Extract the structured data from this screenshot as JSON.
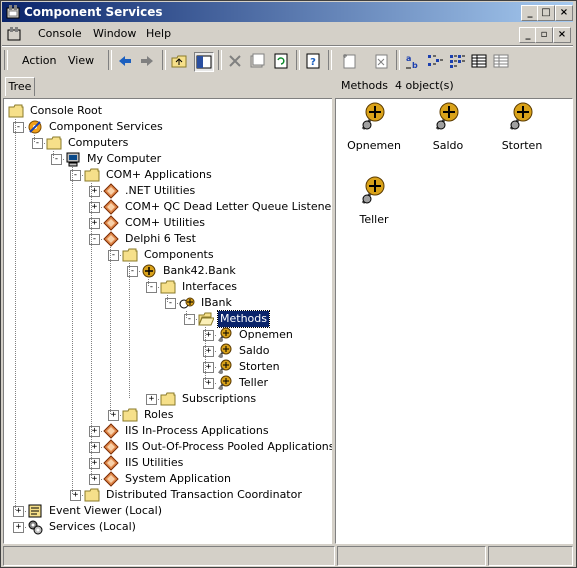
{
  "window": {
    "title": "Component Services",
    "controls": [
      "_",
      "□",
      "×"
    ],
    "inner_controls": [
      "_",
      "▫",
      "×"
    ]
  },
  "menubar": {
    "items": [
      "Console",
      "Window",
      "Help"
    ]
  },
  "toolbar": {
    "action_label": "Action",
    "view_label": "View"
  },
  "tree_tab": {
    "label": "Tree"
  },
  "tree": {
    "nodes": [
      {
        "label": "Console Root",
        "icon": "folder-icon"
      },
      {
        "label": "Component Services",
        "icon": "component-services-icon"
      },
      {
        "label": "Computers",
        "icon": "folder-icon"
      },
      {
        "label": "My Computer",
        "icon": "computer-icon"
      },
      {
        "label": "COM+ Applications",
        "icon": "folder-icon"
      },
      {
        "label": ".NET Utilities",
        "icon": "application-icon"
      },
      {
        "label": "COM+ QC Dead Letter Queue Listener",
        "icon": "application-icon"
      },
      {
        "label": "COM+ Utilities",
        "icon": "application-icon"
      },
      {
        "label": "Delphi 6 Test",
        "icon": "application-icon"
      },
      {
        "label": "Components",
        "icon": "folder-icon"
      },
      {
        "label": "Bank42.Bank",
        "icon": "component-icon"
      },
      {
        "label": "Interfaces",
        "icon": "folder-icon"
      },
      {
        "label": "IBank",
        "icon": "interface-icon"
      },
      {
        "label": "Methods",
        "icon": "folder-open-icon"
      },
      {
        "label": "Opnemen",
        "icon": "method-icon"
      },
      {
        "label": "Saldo",
        "icon": "method-icon"
      },
      {
        "label": "Storten",
        "icon": "method-icon"
      },
      {
        "label": "Teller",
        "icon": "method-icon"
      },
      {
        "label": "Subscriptions",
        "icon": "folder-icon"
      },
      {
        "label": "Roles",
        "icon": "folder-icon"
      },
      {
        "label": "IIS In-Process Applications",
        "icon": "application-icon"
      },
      {
        "label": "IIS Out-Of-Process Pooled Applications",
        "icon": "application-icon"
      },
      {
        "label": "IIS Utilities",
        "icon": "application-icon"
      },
      {
        "label": "System Application",
        "icon": "application-icon"
      },
      {
        "label": "Distributed Transaction Coordinator",
        "icon": "folder-icon"
      },
      {
        "label": "Event Viewer (Local)",
        "icon": "event-viewer-icon"
      },
      {
        "label": "Services (Local)",
        "icon": "services-icon"
      }
    ]
  },
  "right_pane": {
    "header_title": "Methods",
    "header_count": "4 object(s)",
    "items": [
      "Opnemen",
      "Saldo",
      "Storten",
      "Teller"
    ]
  },
  "colors": {
    "titlebar": "#0a246a",
    "selection": "#0a246a",
    "face": "#d4d0c8",
    "method_ball": "#d9a21a"
  }
}
